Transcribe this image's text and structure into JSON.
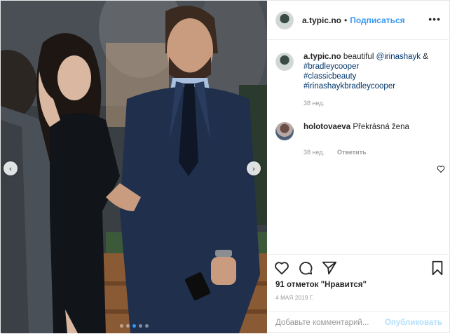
{
  "post": {
    "username": "a.typic.no",
    "separator": "•",
    "follow_label": "Подписаться",
    "more_label": "•••",
    "caption": {
      "username": "a.typic.no",
      "text": "beautiful",
      "mention": "@irinashayk",
      "amp": "&",
      "tags": [
        "#bradleycooper",
        "#classicbeauty",
        "#irinashaykbradleycooper"
      ],
      "time": "38 нед."
    },
    "comments": [
      {
        "username": "holotovaeva",
        "text": "Překrásná žena",
        "time": "38 нед.",
        "reply_label": "Ответить"
      }
    ],
    "likes": "91 отметок \"Нравится\"",
    "date": "4 МАЯ 2019 Г.",
    "comment_placeholder": "Добавьте комментарий...",
    "publish_label": "Опубликовать"
  },
  "carousel": {
    "prev_icon": "‹",
    "next_icon": "›",
    "slide_count": 5,
    "active_slide": 2
  },
  "icons": [
    "heart-icon",
    "comment-icon",
    "share-icon",
    "bookmark-icon",
    "chevron-left-icon",
    "chevron-right-icon"
  ],
  "colors": {
    "link": "#3897f0",
    "hashtag": "#003569",
    "muted": "#999999",
    "text": "#262626"
  }
}
